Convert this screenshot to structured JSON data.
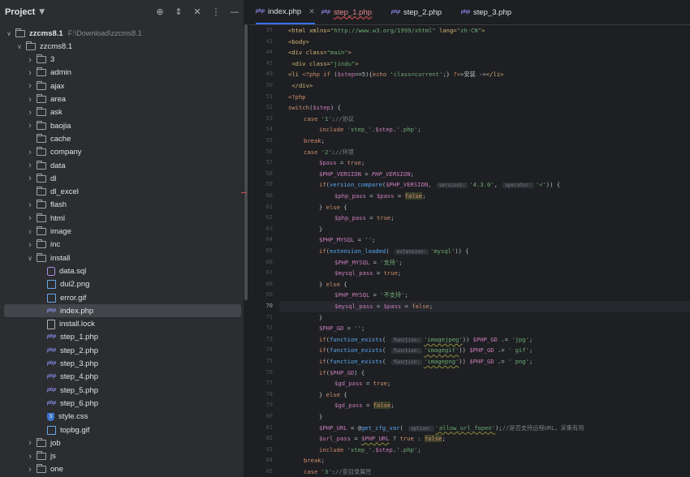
{
  "sidebar": {
    "title": "Project",
    "tools": [
      "crosshair-icon",
      "expand-icon",
      "collapse-icon",
      "more-icon",
      "minimize-icon"
    ],
    "tree": [
      {
        "label": "zzcms8.1",
        "path": "F:\\Download\\zzcms8.1",
        "type": "folder",
        "depth": 0,
        "open": true,
        "bold": true
      },
      {
        "label": "zzcms8.1",
        "type": "folder",
        "depth": 1,
        "open": true
      },
      {
        "label": "3",
        "type": "folder",
        "depth": 2
      },
      {
        "label": "admin",
        "type": "folder",
        "depth": 2
      },
      {
        "label": "ajax",
        "type": "folder",
        "depth": 2
      },
      {
        "label": "area",
        "type": "folder",
        "depth": 2
      },
      {
        "label": "ask",
        "type": "folder",
        "depth": 2
      },
      {
        "label": "baojia",
        "type": "folder",
        "depth": 2
      },
      {
        "label": "cache",
        "type": "folder",
        "depth": 2,
        "noarrow": true
      },
      {
        "label": "company",
        "type": "folder",
        "depth": 2
      },
      {
        "label": "data",
        "type": "folder",
        "depth": 2
      },
      {
        "label": "dl",
        "type": "folder",
        "depth": 2
      },
      {
        "label": "dl_excel",
        "type": "folder",
        "depth": 2,
        "noarrow": true
      },
      {
        "label": "flash",
        "type": "folder",
        "depth": 2
      },
      {
        "label": "html",
        "type": "folder",
        "depth": 2
      },
      {
        "label": "image",
        "type": "folder",
        "depth": 2
      },
      {
        "label": "inc",
        "type": "folder",
        "depth": 2
      },
      {
        "label": "install",
        "type": "folder",
        "depth": 2,
        "open": true
      },
      {
        "label": "data.sql",
        "type": "sql",
        "depth": 3
      },
      {
        "label": "dui2.png",
        "type": "img",
        "depth": 3
      },
      {
        "label": "error.gif",
        "type": "img",
        "depth": 3
      },
      {
        "label": "index.php",
        "type": "php",
        "depth": 3,
        "selected": true
      },
      {
        "label": "install.lock",
        "type": "lock",
        "depth": 3
      },
      {
        "label": "step_1.php",
        "type": "php",
        "depth": 3
      },
      {
        "label": "step_2.php",
        "type": "php",
        "depth": 3
      },
      {
        "label": "step_3.php",
        "type": "php",
        "depth": 3
      },
      {
        "label": "step_4.php",
        "type": "php",
        "depth": 3
      },
      {
        "label": "step_5.php",
        "type": "php",
        "depth": 3
      },
      {
        "label": "step_6.php",
        "type": "php",
        "depth": 3
      },
      {
        "label": "style.css",
        "type": "css",
        "depth": 3
      },
      {
        "label": "topbg.gif",
        "type": "img",
        "depth": 3
      },
      {
        "label": "job",
        "type": "folder",
        "depth": 2
      },
      {
        "label": "js",
        "type": "folder",
        "depth": 2
      },
      {
        "label": "one",
        "type": "folder",
        "depth": 2
      }
    ]
  },
  "tabs": [
    {
      "label": "index.php",
      "icon": "php",
      "active": true,
      "closable": true
    },
    {
      "label": "step_1.php",
      "icon": "php",
      "error": true
    },
    {
      "label": "step_2.php",
      "icon": "php"
    },
    {
      "label": "step_3.php",
      "icon": "php"
    }
  ],
  "editor": {
    "current_line": 70,
    "lines": [
      {
        "n": 35,
        "html": "<span class=\"tg\">&lt;html </span><span class=\"tg\">xmlns=</span><span class=\"s\">\"http://www.w3.org/1999/xhtml\"</span><span class=\"tg\"> lang=</span><span class=\"s\">\"zh-CN\"</span><span class=\"tg\">&gt;</span>",
        "i": 1
      },
      {
        "n": 43,
        "html": "<span class=\"tg\">&lt;body&gt;</span>",
        "i": 1
      },
      {
        "n": 44,
        "html": "<span class=\"tg\">&lt;div </span><span class=\"tg\">class=</span><span class=\"s\">\"main\"</span><span class=\"tg\">&gt;</span>",
        "i": 1
      },
      {
        "n": 45,
        "html": " <span class=\"tg\">&lt;div </span><span class=\"tg\">class=</span><span class=\"s\">\"jindu\"</span><span class=\"tg\">&gt;</span>",
        "i": 1
      },
      {
        "n": 49,
        "html": "<span class=\"tg\">&lt;li </span><span class=\"k\">&lt;?php if</span> (<span class=\"v\">$step</span>==5){<span class=\"k\">echo</span> <span class=\"s\">'class=current'</span>;} <span class=\"k\">?&gt;</span>&gt;安装 -&gt;<span class=\"tg\">&lt;/li&gt;</span>",
        "i": 1
      },
      {
        "n": 50,
        "html": " <span class=\"tg\">&lt;/div&gt;</span>",
        "i": 1
      },
      {
        "n": 51,
        "html": "<span class=\"k\">&lt;?php</span>",
        "i": 1
      },
      {
        "n": 52,
        "html": "<span class=\"k\">switch</span>(<span class=\"v\">$step</span>) {",
        "i": 1
      },
      {
        "n": 53,
        "html": "<span class=\"k\">case</span> <span class=\"s\">'1'</span>:<span class=\"c\">//协议</span>",
        "i": 2
      },
      {
        "n": 54,
        "html": "<span class=\"k\">include</span> <span class=\"s\">'step_'</span>.<span class=\"v\">$step</span>.<span class=\"s\">'.php'</span>;",
        "i": 3
      },
      {
        "n": 55,
        "html": "<span class=\"k\">break</span>;",
        "i": 2
      },
      {
        "n": 56,
        "html": "<span class=\"k\">case</span> <span class=\"s\">'2'</span>:<span class=\"c\">//环境</span>",
        "i": 2
      },
      {
        "n": 57,
        "html": "<span class=\"v\">$pass</span> = <span class=\"k\">true</span>;",
        "i": 3
      },
      {
        "n": 58,
        "html": "<span class=\"v\">$PHP_VERSION</span> = <span class=\"p\">PHP_VERSION</span>;",
        "i": 3
      },
      {
        "n": 59,
        "html": "<span class=\"k\">if</span>(<span class=\"f\">version_compare</span>(<span class=\"v\">$PHP_VERSION</span>, <span class=\"hint\">version2:</span><span class=\"s\">'4.3.0'</span>, <span class=\"hint\">operator:</span><span class=\"s\">'&lt;'</span>)) {",
        "i": 3
      },
      {
        "n": 60,
        "html": "<span class=\"v\">$php_pass</span> = <span class=\"v\">$pass</span> = <span class=\"k hl\">false</span>;",
        "i": 4
      },
      {
        "n": 61,
        "html": "} <span class=\"k\">else</span> {",
        "i": 3
      },
      {
        "n": 62,
        "html": "<span class=\"v\">$php_pass</span> = <span class=\"k\">true</span>;",
        "i": 4
      },
      {
        "n": 63,
        "html": "}",
        "i": 3
      },
      {
        "n": 64,
        "html": "<span class=\"v\">$PHP_MYSQL</span> = <span class=\"s\">''</span>;",
        "i": 3
      },
      {
        "n": 65,
        "html": "<span class=\"k\">if</span>(<span class=\"f\">extension_loaded</span>( <span class=\"hint\">extension:</span><span class=\"s\">'mysql'</span>)) {",
        "i": 3
      },
      {
        "n": 66,
        "html": "<span class=\"v\">$PHP_MYSQL</span> = <span class=\"s\">'支持'</span>;",
        "i": 4
      },
      {
        "n": 67,
        "html": "<span class=\"v\">$mysql_pass</span> = <span class=\"k\">true</span>;",
        "i": 4
      },
      {
        "n": 68,
        "html": "} <span class=\"k\">else</span> {",
        "i": 3
      },
      {
        "n": 69,
        "html": "<span class=\"v\">$PHP_MYSQL</span> = <span class=\"s\">'不支持'</span>;",
        "i": 4
      },
      {
        "n": 70,
        "html": "<span class=\"v\">$mysql_pass</span> = <span class=\"v\">$pass</span> = <span class=\"k\">false</span>;",
        "i": 4
      },
      {
        "n": 71,
        "html": "}",
        "i": 3
      },
      {
        "n": 72,
        "html": "<span class=\"v\">$PHP_GD</span> = <span class=\"s\">''</span>;",
        "i": 3
      },
      {
        "n": 73,
        "html": "<span class=\"k\">if</span>(<span class=\"f\">function_exists</span>( <span class=\"hint\">function:</span><span class=\"s wav\">'imagejpeg'</span>)) <span class=\"v\">$PHP_GD</span> .= <span class=\"s\">'jpg'</span>;",
        "i": 3
      },
      {
        "n": 74,
        "html": "<span class=\"k\">if</span>(<span class=\"f\">function_exists</span>( <span class=\"hint\">function:</span><span class=\"s wav\">'imagegif'</span>)) <span class=\"v\">$PHP_GD</span> .= <span class=\"s\">' gif'</span>;",
        "i": 3
      },
      {
        "n": 75,
        "html": "<span class=\"k\">if</span>(<span class=\"f\">function_exists</span>( <span class=\"hint\">function:</span><span class=\"s wav\">'imagepng'</span>)) <span class=\"v\">$PHP_GD</span> .= <span class=\"s\">' png'</span>;",
        "i": 3
      },
      {
        "n": 76,
        "html": "<span class=\"k\">if</span>(<span class=\"v\">$PHP_GD</span>) {",
        "i": 3
      },
      {
        "n": 77,
        "html": "<span class=\"v\">$gd_pass</span> = <span class=\"k\">true</span>;",
        "i": 4
      },
      {
        "n": 78,
        "html": "} <span class=\"k\">else</span> {",
        "i": 3
      },
      {
        "n": 79,
        "html": "<span class=\"v\">$gd_pass</span> = <span class=\"k hl\">false</span>;",
        "i": 4
      },
      {
        "n": 80,
        "html": "}",
        "i": 3
      },
      {
        "n": 81,
        "html": "<span class=\"v\">$PHP_URL</span> = @<span class=\"f\">get_cfg_var</span>( <span class=\"hint\">option:</span><span class=\"s wav\">'allow_url_fopen'</span>);<span class=\"c\">//是否支持远程URL，采集有用</span>",
        "i": 3
      },
      {
        "n": 82,
        "html": "<span class=\"v\">$url_pass</span> = <span class=\"v wav\">$PHP_URL</span> ? <span class=\"k\">true</span> : <span class=\"k hl\">false</span>;",
        "i": 3
      },
      {
        "n": 83,
        "html": "<span class=\"k\">include</span> <span class=\"s\">'step_'</span>.<span class=\"v\">$step</span>.<span class=\"s\">'.php'</span>;",
        "i": 3
      },
      {
        "n": 84,
        "html": "<span class=\"k\">break</span>;",
        "i": 2
      },
      {
        "n": 85,
        "html": "<span class=\"k\">case</span> <span class=\"s\">'3'</span>:<span class=\"c\">//查目录属性</span>",
        "i": 2
      }
    ]
  }
}
